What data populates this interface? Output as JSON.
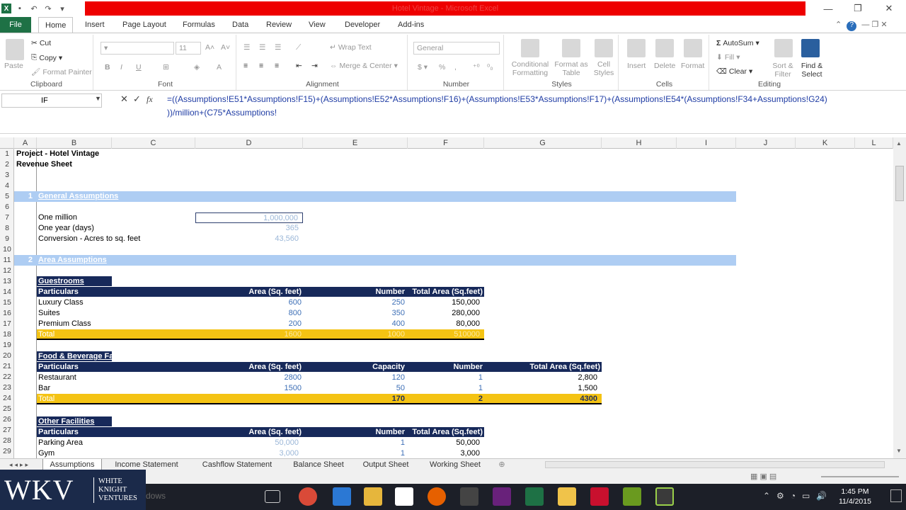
{
  "window": {
    "title_hidden": "Hotel Vintage - Microsoft Excel",
    "minimize": "—",
    "restore": "❐",
    "close": "✕"
  },
  "ribbon_tabs": [
    "File",
    "Home",
    "Insert",
    "Page Layout",
    "Formulas",
    "Data",
    "Review",
    "View",
    "Developer",
    "Add-ins"
  ],
  "ribbon": {
    "clipboard": {
      "paste": "Paste",
      "cut": "Cut",
      "copy": "Copy",
      "format_painter": "Format Painter",
      "label": "Clipboard"
    },
    "font": {
      "size": "11",
      "label": "Font"
    },
    "alignment": {
      "wrap": "Wrap Text",
      "merge": "Merge & Center",
      "label": "Alignment"
    },
    "number": {
      "format": "General",
      "label": "Number"
    },
    "styles": {
      "cond": "Conditional Formatting",
      "table": "Format as Table",
      "cell": "Cell Styles",
      "label": "Styles"
    },
    "cells": {
      "insert": "Insert",
      "delete": "Delete",
      "format": "Format",
      "label": "Cells"
    },
    "editing": {
      "autosum": "AutoSum",
      "fill": "Fill",
      "clear": "Clear",
      "sort": "Sort & Filter",
      "find": "Find & Select",
      "label": "Editing"
    }
  },
  "formula_bar": {
    "name_box": "IF",
    "line1": "=((Assumptions!E51*Assumptions!F15)+(Assumptions!E52*Assumptions!F16)+(Assumptions!E53*Assumptions!F17)+(Assumptions!E54*(Assumptions!F34+Assumptions!G24)",
    "line2": "))/million+(C75*Assumptions!"
  },
  "columns": [
    "A",
    "B",
    "C",
    "D",
    "E",
    "F",
    "G",
    "H",
    "I",
    "J",
    "K",
    "L"
  ],
  "rows": [
    "1",
    "2",
    "3",
    "4",
    "5",
    "6",
    "7",
    "8",
    "9",
    "10",
    "11",
    "12",
    "13",
    "14",
    "15",
    "16",
    "17",
    "18",
    "19",
    "20",
    "21",
    "22",
    "23",
    "24",
    "25",
    "26",
    "27",
    "28",
    "29"
  ],
  "sheet": {
    "title": "Project - Hotel Vintage",
    "subtitle": "Revenue Sheet",
    "sec1_num": "1",
    "sec1_name": "General Assumptions",
    "one_million_label": "One million",
    "one_million_value": "1,000,000",
    "one_year_label": "One year (days)",
    "one_year_value": "365",
    "conversion_label": "Conversion - Acres to sq. feet",
    "conversion_value": "43,560",
    "sec2_num": "2",
    "sec2_name": "Area Assumptions",
    "guestrooms": {
      "title": "Guestrooms",
      "headers": [
        "Particulars",
        "Area  (Sq. feet)",
        "Number",
        "Total Area (Sq.feet)"
      ],
      "rows": [
        [
          "Luxury Class",
          "600",
          "250",
          "150,000"
        ],
        [
          "Suites",
          "800",
          "350",
          "280,000"
        ],
        [
          "Premium Class",
          "200",
          "400",
          "80,000"
        ]
      ],
      "total": [
        "Total",
        "1600",
        "1000",
        "510000"
      ]
    },
    "fnb": {
      "title": "Food & Beverage Fa",
      "headers": [
        "Particulars",
        "Area  (Sq. feet)",
        "Capacity",
        "Number",
        "Total Area (Sq.feet)"
      ],
      "rows": [
        [
          "Restaurant",
          "2800",
          "120",
          "1",
          "2,800"
        ],
        [
          "Bar",
          "1500",
          "50",
          "1",
          "1,500"
        ]
      ],
      "total": [
        "Total",
        "170",
        "2",
        "4300"
      ]
    },
    "other": {
      "title": "Other Facilities",
      "headers": [
        "Particulars",
        "Area  (Sq. feet)",
        "Number",
        "Total Area (Sq.feet)"
      ],
      "rows": [
        [
          "Parking Area",
          "50,000",
          "1",
          "50,000"
        ],
        [
          "Gym",
          "3,000",
          "1",
          "3,000"
        ]
      ]
    }
  },
  "sheet_tabs": [
    "Assumptions",
    "Income Statement",
    "Cashflow Statement",
    "Balance Sheet",
    "Output Sheet",
    "Working Sheet"
  ],
  "branding": {
    "logo": "WKV",
    "line1": "WHITE",
    "line2": "KNIGHT",
    "line3": "VENTURES"
  },
  "taskbar": {
    "search_hint": "dows",
    "time": "1:45 PM",
    "date": "11/4/2015"
  }
}
